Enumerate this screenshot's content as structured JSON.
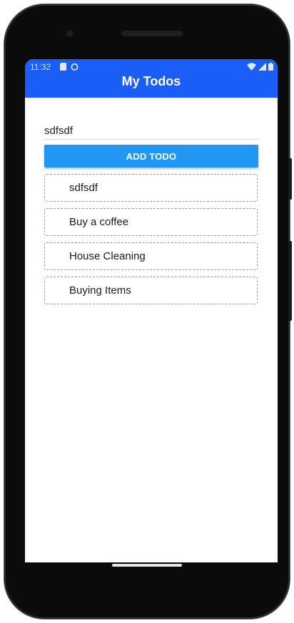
{
  "status_bar": {
    "time": "11:32",
    "left_icons": [
      "sd-card-icon",
      "android-notification-icon"
    ],
    "right_icons": [
      "wifi-icon",
      "cellular-signal-icon",
      "battery-icon"
    ]
  },
  "app_bar": {
    "title": "My Todos",
    "color": "#1a5ef7"
  },
  "form": {
    "input_value": "sdfsdf",
    "add_button_label": "ADD TODO",
    "button_color": "#2196f3"
  },
  "todos": [
    {
      "text": "sdfsdf"
    },
    {
      "text": "Buy a coffee"
    },
    {
      "text": "House Cleaning"
    },
    {
      "text": "Buying Items"
    }
  ]
}
